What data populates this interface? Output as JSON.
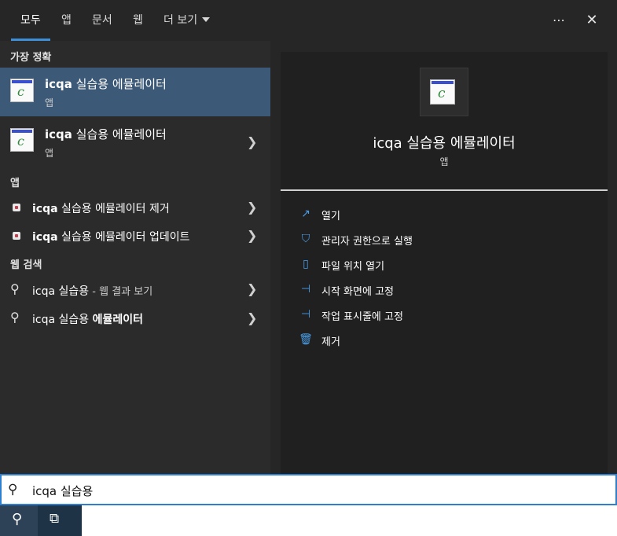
{
  "tabs": [
    {
      "label": "모두"
    },
    {
      "label": "앱"
    },
    {
      "label": "문서"
    },
    {
      "label": "웹"
    },
    {
      "label": "더 보기"
    }
  ],
  "topbar": {
    "more_icon": "⋯",
    "close_icon": "✕"
  },
  "sections": {
    "best_match": "가장 정확",
    "apps": "앱",
    "web": "웹 검색"
  },
  "best_match_items": [
    {
      "title_bold": "icqa",
      "title_rest": " 실습용 에뮬레이터",
      "subtitle": "앱"
    },
    {
      "title_bold": "icqa",
      "title_rest": " 실습용 에뮬레이터",
      "subtitle": "앱"
    }
  ],
  "app_items": [
    {
      "bold": "icqa",
      "rest": " 실습용 에뮬레이터 제거"
    },
    {
      "bold": "icqa",
      "rest": " 실습용 에뮬레이터 업데이트"
    }
  ],
  "web_items": [
    {
      "text": "icqa 실습용",
      "muted": " - 웹 결과 보기"
    },
    {
      "text": "icqa 실습용 ",
      "bold": "에뮬레이터"
    }
  ],
  "preview": {
    "title": "icqa 실습용 에뮬레이터",
    "subtitle": "앱",
    "actions": [
      {
        "label": "열기",
        "icon": "open-icon"
      },
      {
        "label": "관리자 권한으로 실행",
        "icon": "shield-icon"
      },
      {
        "label": "파일 위치 열기",
        "icon": "file-location-icon"
      },
      {
        "label": "시작 화면에 고정",
        "icon": "pin-icon"
      },
      {
        "label": "작업 표시줄에 고정",
        "icon": "pin-icon"
      },
      {
        "label": "제거",
        "icon": "trash-icon"
      }
    ]
  },
  "search": {
    "value": "icqa 실습용"
  },
  "colors": {
    "accent": "#3f8fd8",
    "selected_row": "#3c5a78"
  }
}
